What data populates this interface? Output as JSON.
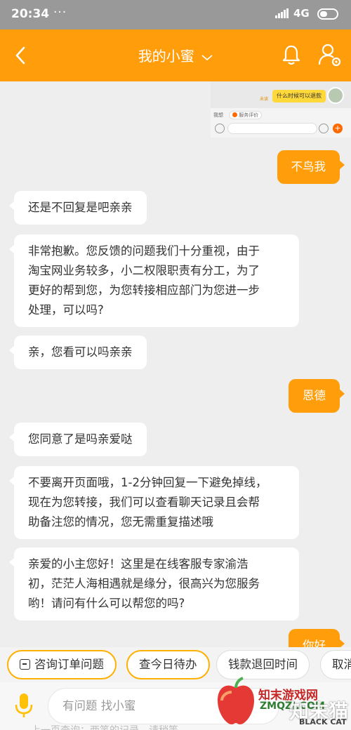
{
  "status_bar": {
    "time": "20:34",
    "dots": "···",
    "network": "4G",
    "colors": {
      "bar": "#999999"
    }
  },
  "header": {
    "title": "我的小蜜",
    "accent": "#ff9d0a"
  },
  "embedded_screenshot": {
    "bubble": "什么时候可以退款",
    "read_label": "未读",
    "row_label": "我想",
    "tag_label": "服务评价"
  },
  "messages": [
    {
      "side": "right",
      "text": "不鸟我"
    },
    {
      "side": "left",
      "text": "还是不回复是吧亲亲"
    },
    {
      "side": "left",
      "lines": [
        "非常抱歉。您反馈的问题我们十分重视，由于",
        "淘宝网业务较多，小二权限职责有分工，为了",
        "更好的帮到您，为您转接相应部门为您进一步",
        "处理，可以吗?"
      ]
    },
    {
      "side": "left",
      "text": "亲，您看可以吗亲亲"
    },
    {
      "side": "right",
      "text": "恩德"
    },
    {
      "side": "left",
      "text": "您同意了是吗亲爱哒"
    },
    {
      "side": "left",
      "lines": [
        "不要离开页面哦，1-2分钟回复一下避免掉线，",
        "现在为您转接，我们可以查看聊天记录且会帮",
        "助备注您的情况，您无需重复描述哦"
      ]
    },
    {
      "side": "left",
      "lines": [
        "亲爱的小主您好！这里是在线客服专家渝浩",
        "初，茫茫人海相遇就是缘分，很高兴为您服务",
        "哟！请问有什么可以帮您的吗?"
      ]
    },
    {
      "side": "right",
      "text": "你好"
    }
  ],
  "quick_replies": [
    "咨询订单问题",
    "查今日待办",
    "钱款退回时间",
    "取消"
  ],
  "input": {
    "placeholder": "有问题 找小蜜",
    "hint": "上一页查询：两笔的记录，请稍等"
  },
  "watermark": {
    "title": "知末游戏网",
    "domain": "ZMQZJ.COM",
    "big": "知末猫",
    "sub": "BLACK CAT"
  }
}
